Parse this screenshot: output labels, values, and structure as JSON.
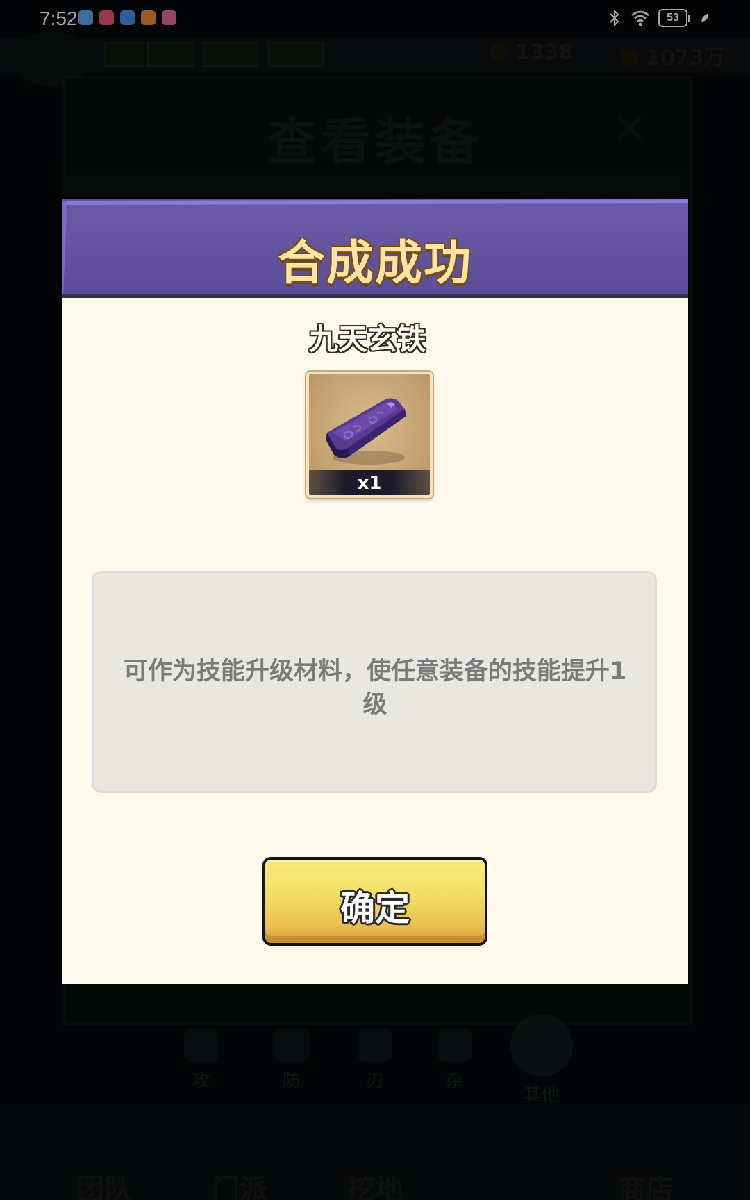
{
  "status_bar": {
    "time": "7:52",
    "battery": "53",
    "notification_icons": [
      {
        "name": "app-icon-1",
        "color": "#5aa9f0"
      },
      {
        "name": "app-icon-2",
        "color": "#e8566a"
      },
      {
        "name": "cloud-icon",
        "color": "#4a8ef0"
      },
      {
        "name": "play-icon",
        "color": "#f0873a"
      },
      {
        "name": "app-icon-5",
        "color": "#e06aa0"
      }
    ]
  },
  "background": {
    "screen_title": "查看装备",
    "resource_1": "1338",
    "resource_2": "1073万",
    "tabs": [
      {
        "label": "攻"
      },
      {
        "label": "防"
      },
      {
        "label": "刃"
      },
      {
        "label": "杂"
      },
      {
        "label": "其他"
      }
    ],
    "nav": [
      {
        "label": "团队"
      },
      {
        "label": "门派"
      },
      {
        "label": "挖地"
      },
      {
        "label": ""
      },
      {
        "label": "商店"
      }
    ]
  },
  "modal": {
    "title": "合成成功",
    "item_name": "九天玄铁",
    "item_quantity": "x1",
    "description": "可作为技能升级材料，使任意装备的技能提升1级",
    "confirm_label": "确定",
    "colors": {
      "header": "#5f4f9b",
      "header_light": "#8a77d6",
      "body": "#fff9ec",
      "button": "#f3dd63",
      "item": "#4b2f7e"
    }
  }
}
